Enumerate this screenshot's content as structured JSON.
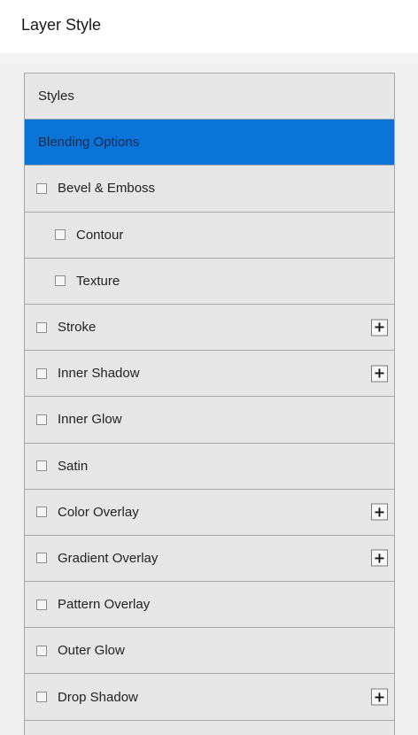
{
  "window": {
    "title": "Layer Style"
  },
  "styles_list": {
    "header": "Styles",
    "selected_item": "Blending Options",
    "items": [
      {
        "label": "Bevel & Emboss",
        "checked": false,
        "indent": 0,
        "has_add": false
      },
      {
        "label": "Contour",
        "checked": false,
        "indent": 1,
        "has_add": false
      },
      {
        "label": "Texture",
        "checked": false,
        "indent": 1,
        "has_add": false
      },
      {
        "label": "Stroke",
        "checked": false,
        "indent": 0,
        "has_add": true
      },
      {
        "label": "Inner Shadow",
        "checked": false,
        "indent": 0,
        "has_add": true
      },
      {
        "label": "Inner Glow",
        "checked": false,
        "indent": 0,
        "has_add": false
      },
      {
        "label": "Satin",
        "checked": false,
        "indent": 0,
        "has_add": false
      },
      {
        "label": "Color Overlay",
        "checked": false,
        "indent": 0,
        "has_add": true
      },
      {
        "label": "Gradient Overlay",
        "checked": false,
        "indent": 0,
        "has_add": true
      },
      {
        "label": "Pattern Overlay",
        "checked": false,
        "indent": 0,
        "has_add": false
      },
      {
        "label": "Outer Glow",
        "checked": false,
        "indent": 0,
        "has_add": false
      },
      {
        "label": "Drop Shadow",
        "checked": false,
        "indent": 0,
        "has_add": true
      }
    ],
    "add_button_glyph": "+"
  },
  "colors": {
    "selection_bg": "#0a74d9",
    "list_bg": "#e6e6e6",
    "divider": "#a8a8a8"
  }
}
